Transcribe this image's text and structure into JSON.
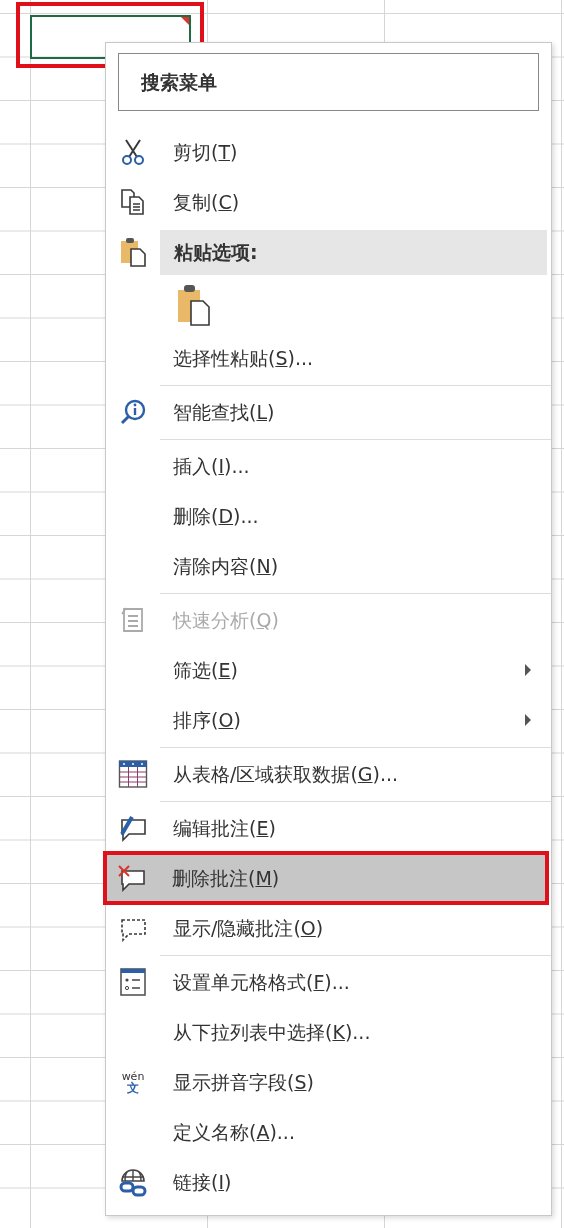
{
  "cell": {
    "selected": true,
    "has_comment": true,
    "callout": true
  },
  "menu": {
    "search": {
      "placeholder": "搜索菜单"
    },
    "items": [
      {
        "kind": "item",
        "label": "剪切(",
        "key": "T",
        "tail": ")",
        "disabled": false,
        "submenu": false,
        "highlighted": false
      },
      {
        "kind": "item",
        "label": "复制(",
        "key": "C",
        "tail": ")",
        "disabled": false,
        "submenu": false,
        "highlighted": false
      },
      {
        "kind": "header",
        "label": "粘贴选项:"
      },
      {
        "kind": "paste-button"
      },
      {
        "kind": "item",
        "label": "选择性粘贴(",
        "key": "S",
        "tail": ")...",
        "disabled": false,
        "submenu": false,
        "highlighted": false
      },
      {
        "kind": "separator"
      },
      {
        "kind": "item",
        "label": "智能查找(",
        "key": "L",
        "tail": ")",
        "disabled": false,
        "submenu": false,
        "highlighted": false
      },
      {
        "kind": "separator"
      },
      {
        "kind": "item",
        "label": "插入(",
        "key": "I",
        "tail": ")...",
        "disabled": false,
        "submenu": false,
        "highlighted": false
      },
      {
        "kind": "item",
        "label": "删除(",
        "key": "D",
        "tail": ")...",
        "disabled": false,
        "submenu": false,
        "highlighted": false
      },
      {
        "kind": "item",
        "label": "清除内容(",
        "key": "N",
        "tail": ")",
        "disabled": false,
        "submenu": false,
        "highlighted": false
      },
      {
        "kind": "separator"
      },
      {
        "kind": "item",
        "label": "快速分析(",
        "key": "Q",
        "tail": ")",
        "disabled": true,
        "submenu": false,
        "highlighted": false
      },
      {
        "kind": "item",
        "label": "筛选(",
        "key": "E",
        "tail": ")",
        "disabled": false,
        "submenu": true,
        "highlighted": false
      },
      {
        "kind": "item",
        "label": "排序(",
        "key": "O",
        "tail": ")",
        "disabled": false,
        "submenu": true,
        "highlighted": false
      },
      {
        "kind": "separator"
      },
      {
        "kind": "item",
        "label": "从表格/区域获取数据(",
        "key": "G",
        "tail": ")...",
        "disabled": false,
        "submenu": false,
        "highlighted": false
      },
      {
        "kind": "separator"
      },
      {
        "kind": "item",
        "label": "编辑批注(",
        "key": "E",
        "tail": ")",
        "disabled": false,
        "submenu": false,
        "highlighted": false
      },
      {
        "kind": "item",
        "label": "删除批注(",
        "key": "M",
        "tail": ")",
        "disabled": false,
        "submenu": false,
        "highlighted": true
      },
      {
        "kind": "item",
        "label": "显示/隐藏批注(",
        "key": "O",
        "tail": ")",
        "disabled": false,
        "submenu": false,
        "highlighted": false
      },
      {
        "kind": "separator"
      },
      {
        "kind": "item",
        "label": "设置单元格格式(",
        "key": "F",
        "tail": ")...",
        "disabled": false,
        "submenu": false,
        "highlighted": false
      },
      {
        "kind": "item",
        "label": "从下拉列表中选择(",
        "key": "K",
        "tail": ")...",
        "disabled": false,
        "submenu": false,
        "highlighted": false
      },
      {
        "kind": "item",
        "label": "显示拼音字段(",
        "key": "S",
        "tail": ")",
        "disabled": false,
        "submenu": false,
        "highlighted": false,
        "icon_glyphs": [
          "wén",
          "文"
        ]
      },
      {
        "kind": "item",
        "label": "定义名称(",
        "key": "A",
        "tail": ")...",
        "disabled": false,
        "submenu": false,
        "highlighted": false
      },
      {
        "kind": "item",
        "label": "链接(",
        "key": "I",
        "tail": ")",
        "disabled": false,
        "submenu": false,
        "highlighted": false
      }
    ]
  }
}
